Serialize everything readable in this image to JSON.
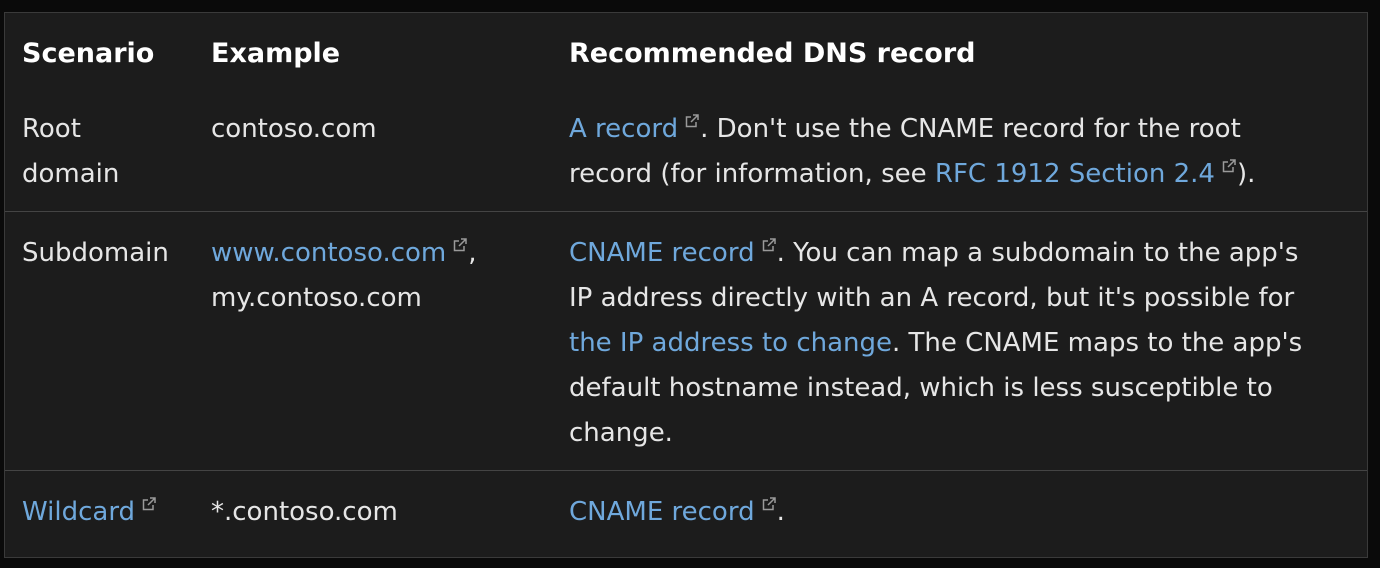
{
  "table": {
    "headers": [
      "Scenario",
      "Example",
      "Recommended DNS record"
    ],
    "rows": [
      {
        "scenario_line1": "Root",
        "scenario_line2": "domain",
        "example": "contoso.com",
        "rec_link": "A record",
        "rec_text1": ". Don't use the CNAME record for the root",
        "rec_text2": "record (for information, see ",
        "rec_link2": "RFC 1912 Section 2.4",
        "rec_text3": ")."
      },
      {
        "scenario": "Subdomain",
        "example_link": "www.contoso.com",
        "example_sep": ",",
        "example2": "my.contoso.com",
        "rec_link": "CNAME record",
        "rec_text1": ". You can map a subdomain to the app's",
        "rec_text2": "IP address directly with an A record, but it's possible for",
        "rec_link2": "the IP address to change",
        "rec_text3": ". The CNAME maps to the app's",
        "rec_text4": "default hostname instead, which is less susceptible to",
        "rec_text5": "change."
      },
      {
        "scenario_link": "Wildcard",
        "example": "*.contoso.com",
        "rec_link": "CNAME record",
        "rec_text1": "."
      }
    ]
  },
  "colors": {
    "background": "#1c1c1c",
    "text": "#e6e6e6",
    "link": "#6fa8dc",
    "border": "#444444"
  },
  "icons": {
    "external": "external-link-icon"
  }
}
